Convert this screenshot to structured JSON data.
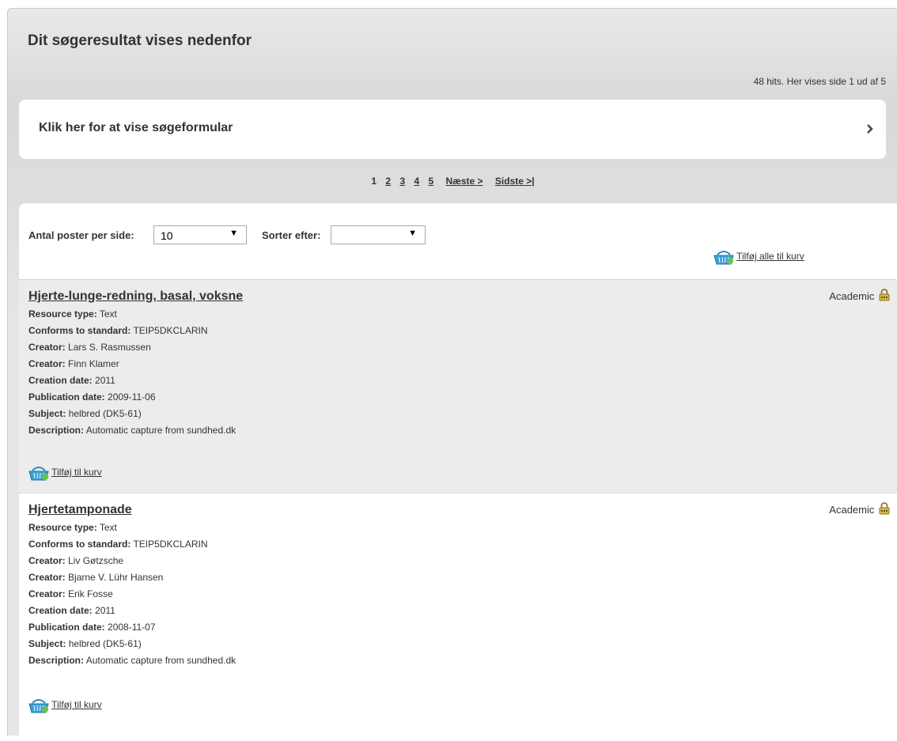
{
  "page": {
    "title": "Dit søgeresultat vises nedenfor",
    "hits_text": "48 hits. Her vises side 1 ud af 5",
    "search_toggle_label": "Klik her for at vise søgeformular"
  },
  "pagination": {
    "pages": [
      "1",
      "2",
      "3",
      "4",
      "5"
    ],
    "current": "1",
    "next": "Næste >",
    "last": "Sidste >|"
  },
  "controls": {
    "per_page_label": "Antal poster per side:",
    "per_page_value": "10",
    "sort_label": "Sorter efter:",
    "sort_value": "",
    "add_all_label": "Tilføj alle til kurv"
  },
  "records": [
    {
      "title": "Hjerte-lunge-redning, basal, voksne",
      "access": "Academic",
      "fields": [
        {
          "label": "Resource type:",
          "value": "Text"
        },
        {
          "label": "Conforms to standard:",
          "value": "TEIP5DKCLARIN"
        },
        {
          "label": "Creator:",
          "value": "Lars S. Rasmussen"
        },
        {
          "label": "Creator:",
          "value": "Finn Klamer"
        },
        {
          "label": "Creation date:",
          "value": "2011"
        },
        {
          "label": "Publication date:",
          "value": "2009-11-06"
        },
        {
          "label": "Subject:",
          "value": "helbred (DK5-61)"
        },
        {
          "label": "Description:",
          "value": "Automatic capture from sundhed.dk"
        }
      ],
      "add_label": "Tilføj til kurv"
    },
    {
      "title": "Hjertetamponade",
      "access": "Academic",
      "fields": [
        {
          "label": "Resource type:",
          "value": "Text"
        },
        {
          "label": "Conforms to standard:",
          "value": "TEIP5DKCLARIN"
        },
        {
          "label": "Creator:",
          "value": "Liv Gøtzsche"
        },
        {
          "label": "Creator:",
          "value": "Bjarne V. Lühr Hansen"
        },
        {
          "label": "Creator:",
          "value": "Erik Fosse"
        },
        {
          "label": "Creation date:",
          "value": "2011"
        },
        {
          "label": "Publication date:",
          "value": "2008-11-07"
        },
        {
          "label": "Subject:",
          "value": "helbred (DK5-61)"
        },
        {
          "label": "Description:",
          "value": "Automatic capture from sundhed.dk"
        }
      ],
      "add_label": "Tilføj til kurv"
    }
  ],
  "icons": {
    "basket": "basket-icon",
    "lock": "lock-icon",
    "chevron": "chevron-right-icon"
  }
}
